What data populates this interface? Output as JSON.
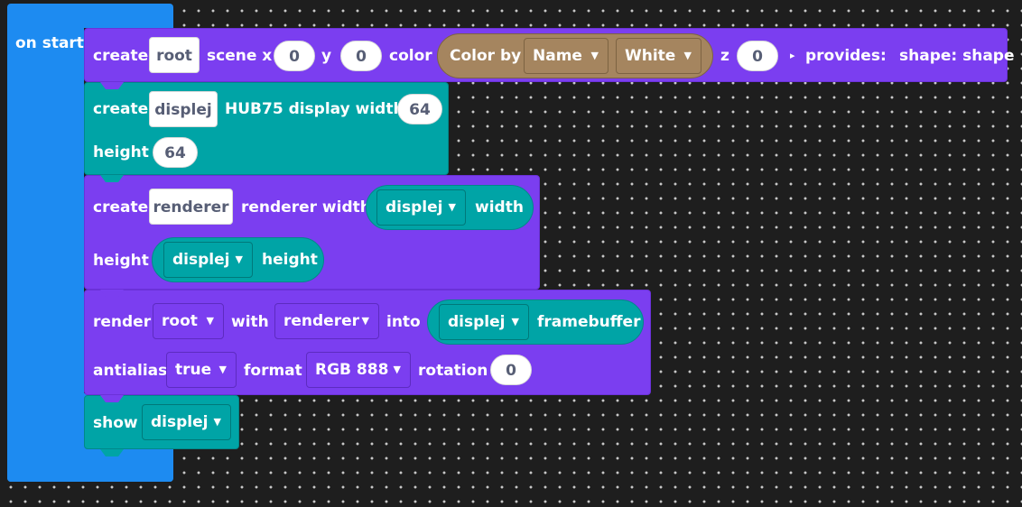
{
  "event": {
    "label": "on start"
  },
  "block1": {
    "create": "create",
    "var": "root",
    "scene_x": "scene x",
    "x": "0",
    "y_label": "y",
    "y": "0",
    "color_label": "color",
    "color_by": "Color by",
    "name_dd": "Name",
    "color_dd": "White",
    "z_label": "z",
    "z": "0",
    "provides": "provides:",
    "shape": "shape: shape",
    "arrow": "▸"
  },
  "block2": {
    "create": "create",
    "var": "displej",
    "text": "HUB75 display width",
    "width": "64",
    "height_label": "height",
    "height": "64"
  },
  "block3": {
    "create": "create",
    "var": "renderer",
    "text": "renderer width",
    "ref1": "displej",
    "width_label": "width",
    "height_label": "height",
    "ref2": "displej",
    "height_prop": "height"
  },
  "block4": {
    "render": "render",
    "root_dd": "root",
    "with": "with",
    "renderer_dd": "renderer",
    "into": "into",
    "displej_dd": "displej",
    "framebuffer": "framebuffer",
    "antialias": "antialias",
    "antialias_dd": "true",
    "format": "format",
    "format_dd": "RGB 888",
    "rotation": "rotation",
    "rotation_val": "0"
  },
  "block5": {
    "show": "show",
    "displej_dd": "displej"
  },
  "caret": "▼",
  "colors": {
    "event": "#1d8bf1",
    "purple": "#7b3ef0",
    "teal": "#00a4a6",
    "color_block": "#a5855f",
    "canvas": "#1e1e1e"
  }
}
